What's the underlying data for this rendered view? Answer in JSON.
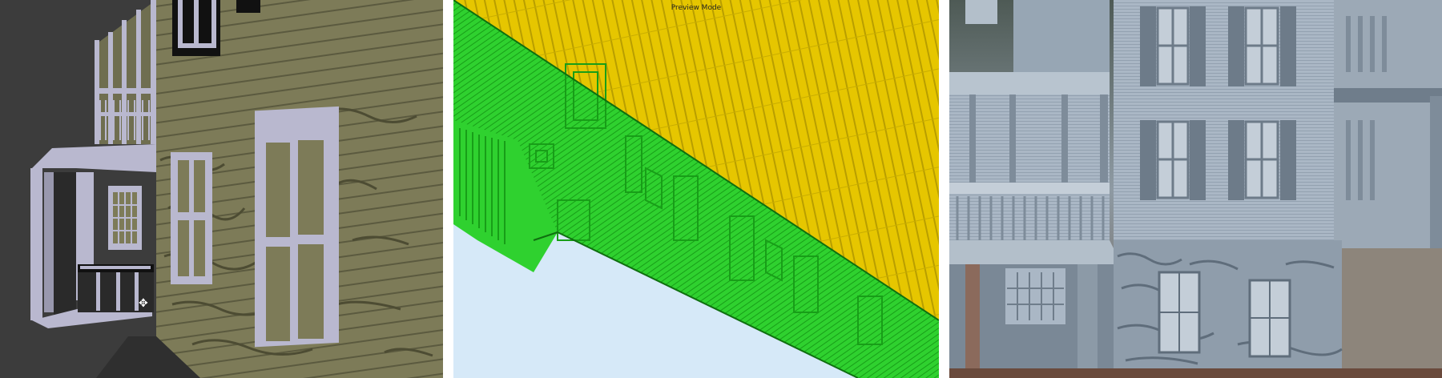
{
  "slicer": {
    "mode_label": "Preview Mode"
  },
  "colors": {
    "viewport_background": "#3c3c3c",
    "model_wall": "#7d7b58",
    "model_trim": "#b9b8cf",
    "slicer_background": "#d6e9f8",
    "slicer_walls": "#2fd12f",
    "slicer_infill": "#e6c600",
    "print_plastic": "#aab7c5"
  },
  "icons": [
    "cursor-crosshair-icon"
  ]
}
